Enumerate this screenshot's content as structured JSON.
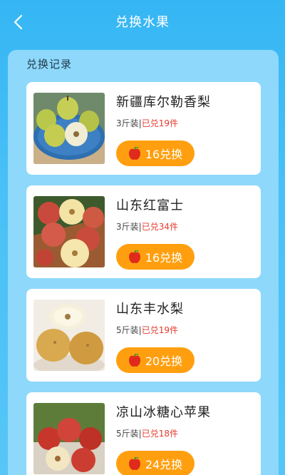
{
  "header": {
    "title": "兑换水果",
    "back_icon": "chevron-left-icon"
  },
  "section": {
    "title": "兑换记录"
  },
  "colors": {
    "accent": "#ff9f0f",
    "sold": "#e63b2e",
    "background": "#35b6f4",
    "panel": "#8ed8fb"
  },
  "products": [
    {
      "name": "新疆库尔勒香梨",
      "spec": "3斤装",
      "sep": "|",
      "sold": "已兑19件",
      "button": "16兑换",
      "icon": "apple-icon"
    },
    {
      "name": "山东红富士",
      "spec": "3斤装",
      "sep": "|",
      "sold": "已兑34件",
      "button": "16兑换",
      "icon": "apple-icon"
    },
    {
      "name": "山东丰水梨",
      "spec": "5斤装",
      "sep": "|",
      "sold": "已兑19件",
      "button": "20兑换",
      "icon": "apple-icon"
    },
    {
      "name": "凉山冰糖心苹果",
      "spec": "5斤装",
      "sep": "|",
      "sold": "已兑18件",
      "button": "24兑换",
      "icon": "apple-icon"
    }
  ]
}
